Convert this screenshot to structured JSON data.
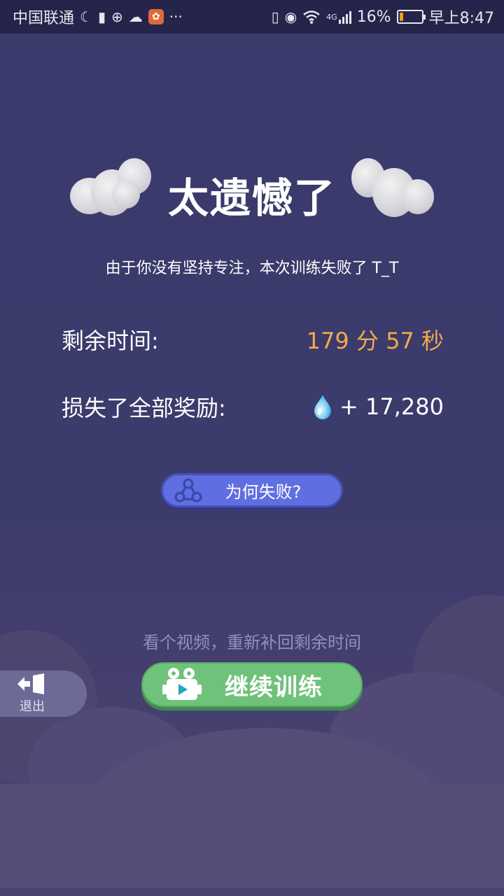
{
  "status_bar": {
    "carrier": "中国联通",
    "network": "4G",
    "battery_percent": "16%",
    "battery_level": 0.16,
    "battery_color": "#f29b1d",
    "time": "早上8:47",
    "icons": [
      "moon-icon",
      "alert-icon",
      "sync-icon",
      "cloud-icon",
      "uc-browser-icon",
      "more-dots-icon",
      "vibrate-icon",
      "eye-icon",
      "wifi-icon",
      "signal-icon",
      "battery-icon"
    ]
  },
  "result": {
    "title": "太遗憾了",
    "subtitle": "由于你没有坚持专注，本次训练失败了 T_T"
  },
  "stats": {
    "remaining_label": "剩余时间:",
    "remaining_value": "179 分 57 秒",
    "lost_label": "损失了全部奖励:",
    "lost_value": "+ 17,280"
  },
  "why_button": {
    "label": "为何失败?"
  },
  "continue_section": {
    "hint": "看个视频，重新补回剩余时间",
    "button_label": "继续训练"
  },
  "exit_button": {
    "label": "退出"
  },
  "colors": {
    "background": "#3a3a6c",
    "accent_orange": "#f3a94c",
    "why_button": "#5f6ee0",
    "continue_button": "#6fc27a",
    "hint_text": "#8d8fc4"
  }
}
